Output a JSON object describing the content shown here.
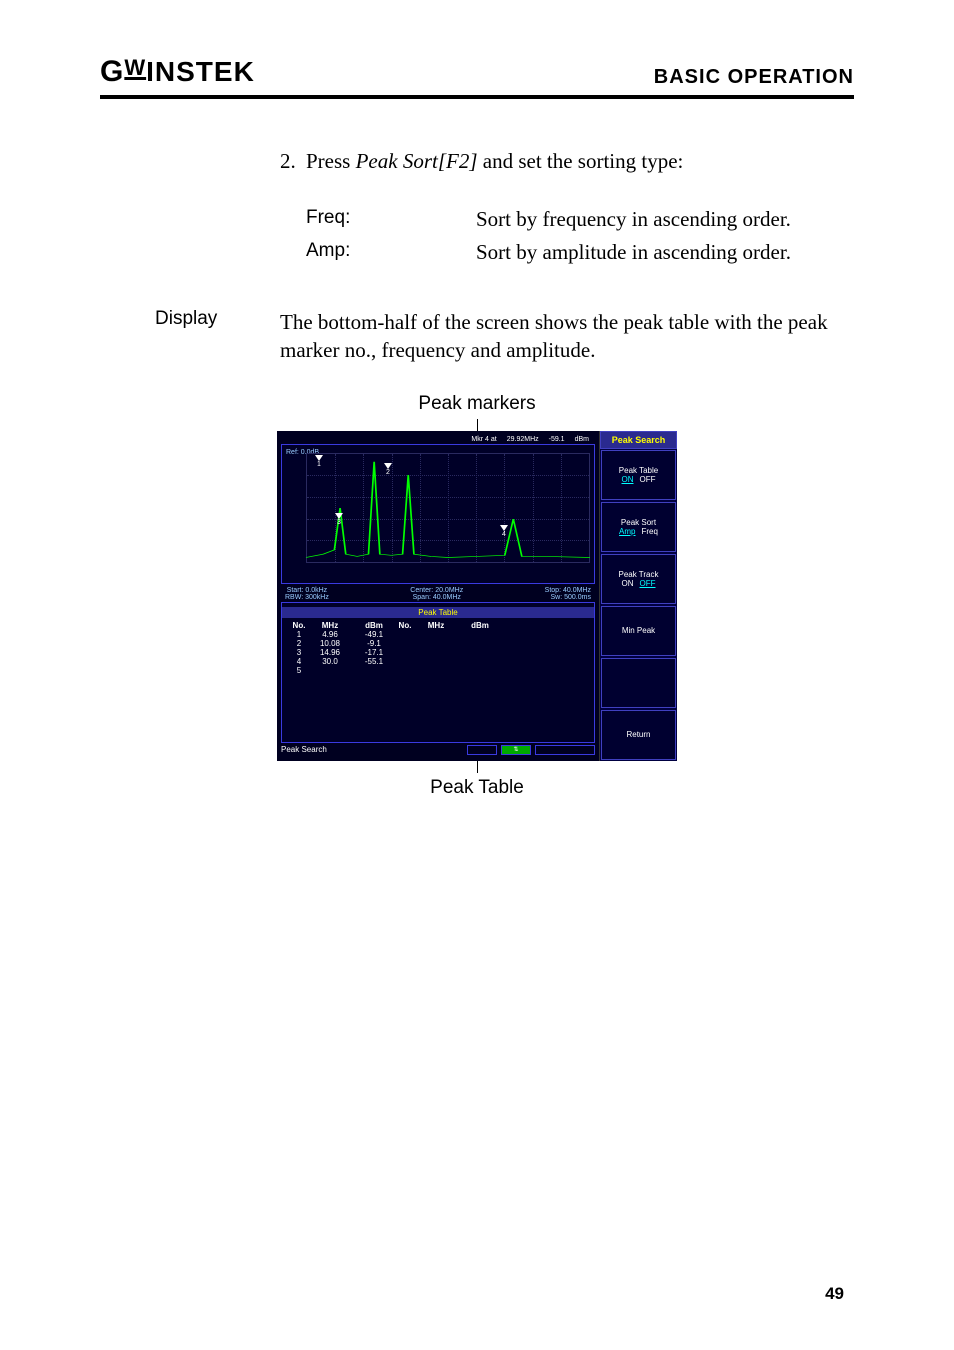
{
  "header": {
    "logo_prefix": "G",
    "logo_w": "W",
    "logo_rest": "INSTEK",
    "section": "BASIC OPERATION"
  },
  "step": {
    "number": "2.",
    "text_pre": "Press ",
    "text_em": "Peak Sort[F2]",
    "text_post": " and set the sorting type:"
  },
  "options": {
    "freq_label": "Freq:",
    "freq_desc": "Sort by frequency in ascending order.",
    "amp_label": "Amp:",
    "amp_desc": "Sort by amplitude in ascending order."
  },
  "display": {
    "label": "Display",
    "text": "The bottom-half of the screen shows the peak table with the peak marker no., frequency and amplitude."
  },
  "figure": {
    "caption_top": "Peak markers",
    "caption_bottom": "Peak Table"
  },
  "screenshot": {
    "topbar": {
      "mkr": "Mkr 4 at",
      "freq": "29.92MHz",
      "amp": "-59.1",
      "unit": "dBm"
    },
    "ref": "Ref: 0.0dB",
    "start": "Start: 0.0kHz",
    "rbw": "RBW: 300kHz",
    "center": "Center: 20.0MHz",
    "span": "Span: 40.0MHz",
    "stop": "Stop: 40.0MHz",
    "sw": "Sw: 500.0ms",
    "side_header": "Peak Search",
    "softkeys": [
      {
        "l1": "Peak Table",
        "l2a": "ON",
        "l2b": "OFF",
        "active": "a"
      },
      {
        "l1": "Peak Sort",
        "l2a": "Amp",
        "l2b": "Freq",
        "active": "a"
      },
      {
        "l1": "Peak Track",
        "l2a": "ON",
        "l2b": "OFF",
        "active": "b"
      },
      {
        "l1": "Min Peak",
        "l2a": "",
        "l2b": "",
        "active": ""
      },
      {
        "l1": "",
        "l2a": "",
        "l2b": "",
        "active": ""
      },
      {
        "l1": "Return",
        "l2a": "",
        "l2b": "",
        "active": ""
      }
    ],
    "status_left": "Peak Search",
    "peak_table": {
      "title": "Peak Table",
      "cols": [
        "No.",
        "MHz",
        "dBm",
        "No.",
        "MHz",
        "dBm"
      ],
      "rows": [
        {
          "no": "1",
          "mhz": "4.96",
          "dbm": "-49.1"
        },
        {
          "no": "2",
          "mhz": "10.08",
          "dbm": "-9.1"
        },
        {
          "no": "3",
          "mhz": "14.96",
          "dbm": "-17.1"
        },
        {
          "no": "4",
          "mhz": "30.0",
          "dbm": "-55.1"
        },
        {
          "no": "5",
          "mhz": "",
          "dbm": ""
        }
      ]
    }
  },
  "pagenum": "49"
}
